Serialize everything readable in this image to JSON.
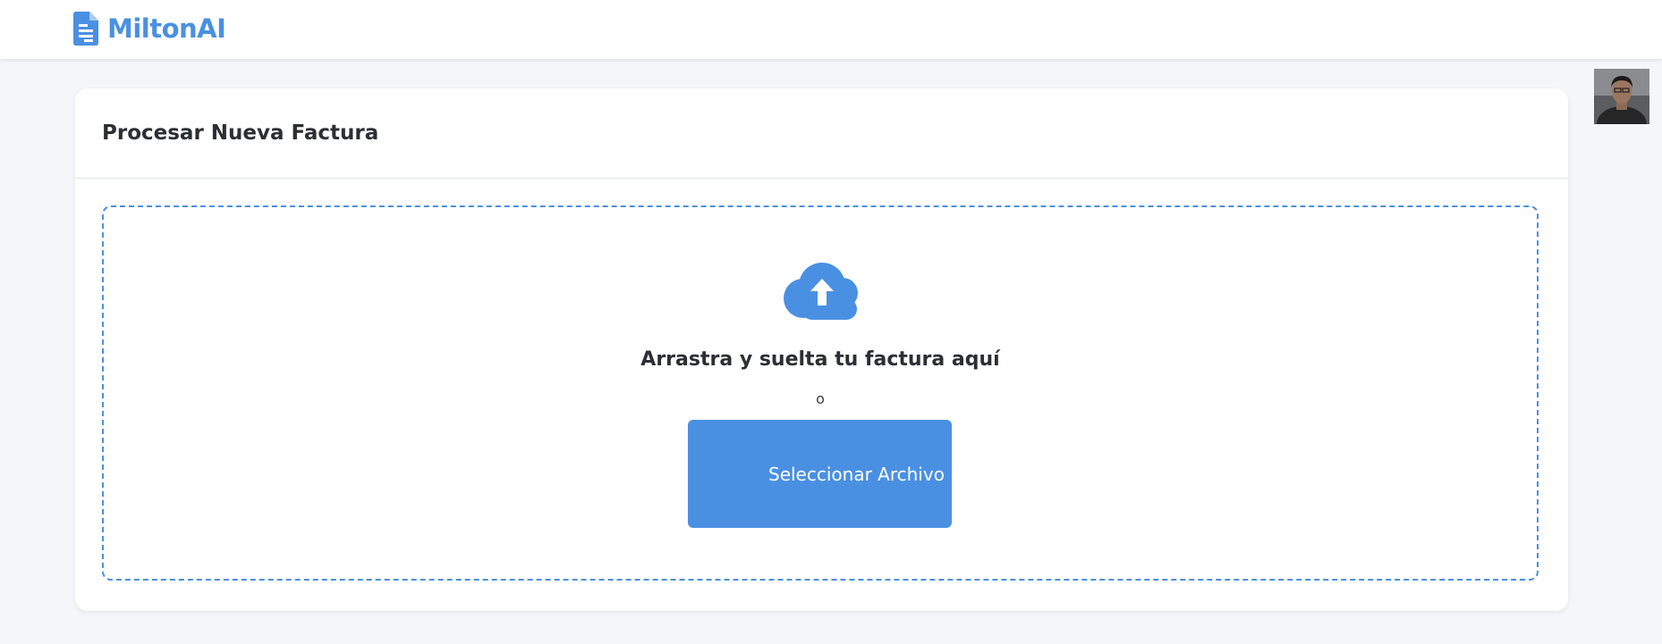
{
  "brand": {
    "name": "MiltonAI",
    "icon": "document-icon",
    "color": "#4a90e2"
  },
  "user": {
    "avatar_icon": "user-avatar"
  },
  "card": {
    "title": "Procesar Nueva Factura"
  },
  "dropzone": {
    "icon": "cloud-upload-icon",
    "title": "Arrastra y suelta tu factura aquí",
    "or_text": "o",
    "button_label": "Seleccionar Archivo",
    "border_color": "#4a90e2"
  },
  "colors": {
    "accent": "#4a90e2",
    "background": "#f4f6fa",
    "text": "#2b2f33"
  }
}
